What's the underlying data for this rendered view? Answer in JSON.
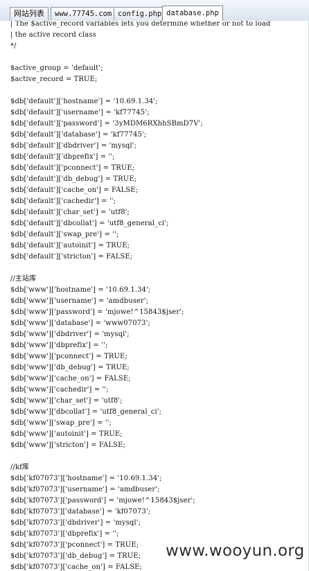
{
  "tabs": [
    {
      "label": "网站列表"
    },
    {
      "label": "www.77745.com"
    },
    {
      "label": "config.php"
    },
    {
      "label": "database.php"
    }
  ],
  "code_lines": [
    "| The $active_record variables lets you determine whether or not to load",
    "| the active record class",
    "*/",
    "",
    "$active_group = 'default';",
    "$active_record = TRUE;",
    "",
    "$db['default']['hostname'] = '10.69.1.34';",
    "$db['default']['username'] = 'kf77745';",
    "$db['default']['password'] = '3yMDM6RXhhSBmD7V';",
    "$db['default']['database'] = 'kf77745';",
    "$db['default']['dbdriver'] = 'mysql';",
    "$db['default']['dbprefix'] = '';",
    "$db['default']['pconnect'] = TRUE;",
    "$db['default']['db_debug'] = TRUE;",
    "$db['default']['cache_on'] = FALSE;",
    "$db['default']['cachedir'] = '';",
    "$db['default']['char_set'] = 'utf8';",
    "$db['default']['dbcollat'] = 'utf8_general_ci';",
    "$db['default']['swap_pre'] = '';",
    "$db['default']['autoinit'] = TRUE;",
    "$db['default']['stricton'] = FALSE;",
    "",
    "//主站库",
    "$db['www']['hostname'] = '10.69.1.34';",
    "$db['www']['username'] = 'amdbuser';",
    "$db['www']['password'] = 'mjowe!^15843$jser';",
    "$db['www']['database'] = 'www07073';",
    "$db['www']['dbdriver'] = 'mysql';",
    "$db['www']['dbprefix'] = '';",
    "$db['www']['pconnect'] = TRUE;",
    "$db['www']['db_debug'] = TRUE;",
    "$db['www']['cache_on'] = FALSE;",
    "$db['www']['cachedir'] = '';",
    "$db['www']['char_set'] = 'utf8';",
    "$db['www']['dbcollat'] = 'utf8_general_ci';",
    "$db['www']['swap_pre'] = '';",
    "$db['www']['autoinit'] = TRUE;",
    "$db['www']['stricton'] = FALSE;",
    "",
    "//kf库",
    "$db['kf07073']['hostname'] = '10.69.1.34';",
    "$db['kf07073']['username'] = 'amdbuser';",
    "$db['kf07073']['password'] = 'mjowe!^15843$jser';",
    "$db['kf07073']['database'] = 'kf07073';",
    "$db['kf07073']['dbdriver'] = 'mysql';",
    "$db['kf07073']['dbprefix'] = '';",
    "$db['kf07073']['pconnect'] = TRUE;",
    "$db['kf07073']['db_debug'] = TRUE;",
    "$db['kf07073']['cache_on'] = FALSE;"
  ],
  "watermark": "www.wooyun.org"
}
